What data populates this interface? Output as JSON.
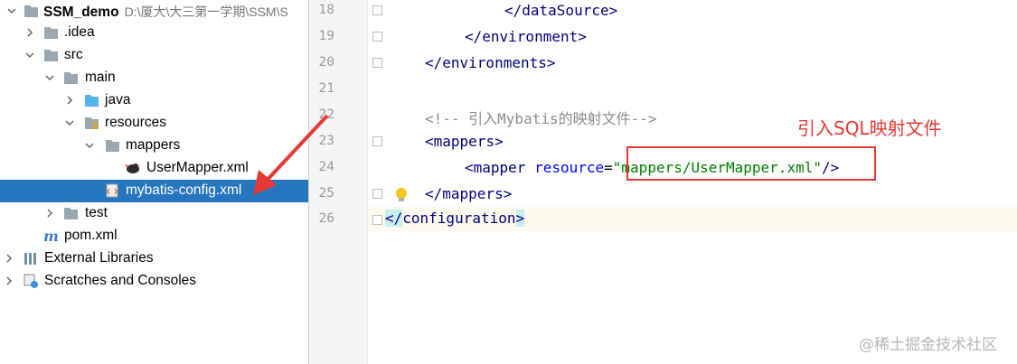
{
  "tree": {
    "items": [
      {
        "label": "SSM_demo",
        "path": "D:\\厦大\\大三第一学期\\SSM\\S"
      },
      {
        "label": ".idea"
      },
      {
        "label": "src"
      },
      {
        "label": "main"
      },
      {
        "label": "java"
      },
      {
        "label": "resources"
      },
      {
        "label": "mappers"
      },
      {
        "label": "UserMapper.xml"
      },
      {
        "label": "mybatis-config.xml"
      },
      {
        "label": "test"
      },
      {
        "label": "pom.xml"
      },
      {
        "label": "External Libraries"
      },
      {
        "label": "Scratches and Consoles"
      }
    ]
  },
  "editor": {
    "line_numbers": [
      "18",
      "19",
      "20",
      "21",
      "22",
      "23",
      "24",
      "25",
      "26"
    ],
    "lines": {
      "l18": {
        "open": "</",
        "name": "dataSource",
        "close": ">"
      },
      "l19": {
        "open": "</",
        "name": "environment",
        "close": ">"
      },
      "l20": {
        "open": "</",
        "name": "environments",
        "close": ">"
      },
      "l22": {
        "comment": "<!-- 引入Mybatis的映射文件-->"
      },
      "l23": {
        "open": "<",
        "name": "mappers",
        "close": ">"
      },
      "l24": {
        "open": "<",
        "name": "mapper",
        "attr": "resource",
        "eq": "=",
        "value": "\"mappers/UserMapper.xml\"",
        "close": "/>"
      },
      "l25": {
        "open": "</",
        "name": "mappers",
        "close": ">"
      },
      "l26": {
        "open": "</",
        "name": "configuration",
        "close": ">"
      }
    }
  },
  "annotation": {
    "text": "引入SQL映射文件",
    "color": "#e53935"
  },
  "watermark": "@稀土掘金技术社区",
  "colors": {
    "selection": "#2675bf",
    "tag": "#000080",
    "attr": "#0000ff",
    "value": "#008000",
    "comment": "#8c8c8c"
  }
}
